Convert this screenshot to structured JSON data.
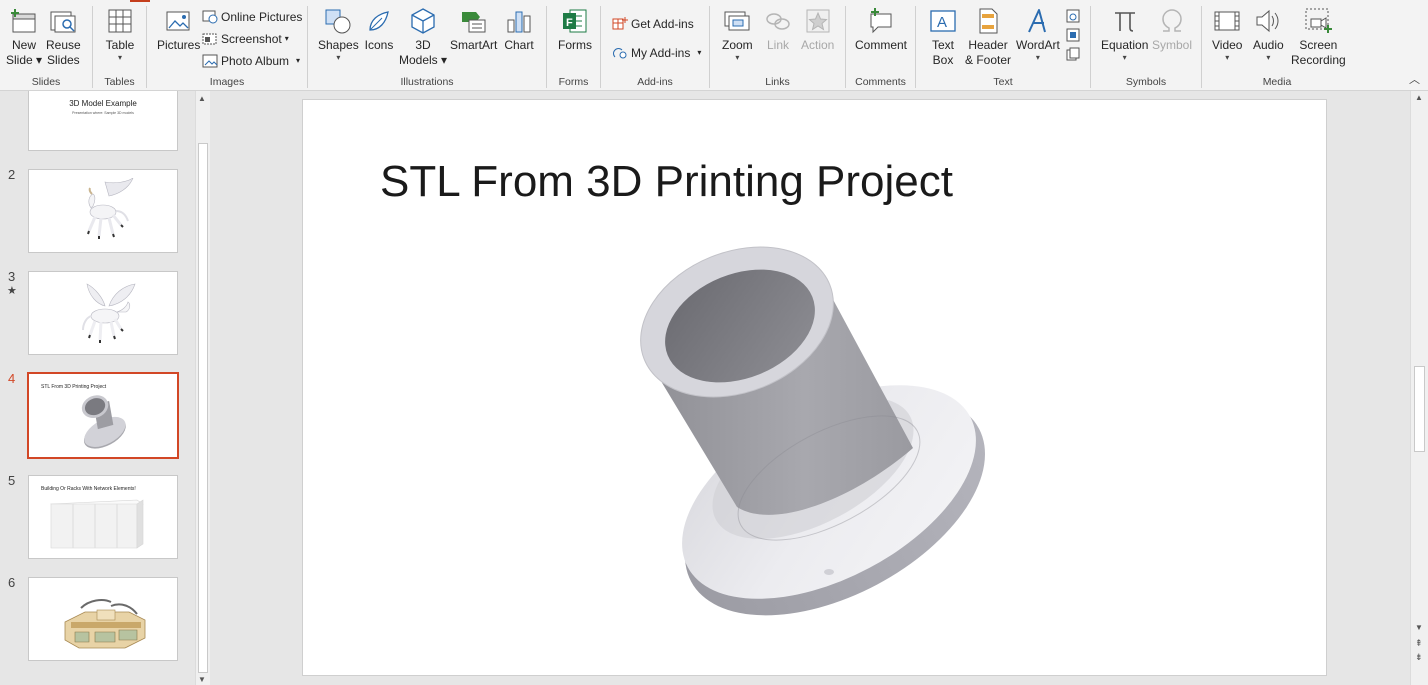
{
  "ribbon": {
    "groups": {
      "slides": "Slides",
      "tables": "Tables",
      "images": "Images",
      "illustrations": "Illustrations",
      "forms": "Forms",
      "addins": "Add-ins",
      "links": "Links",
      "comments": "Comments",
      "text": "Text",
      "symbols": "Symbols",
      "media": "Media"
    },
    "buttons": {
      "new_slide_1": "New",
      "new_slide_2": "Slide",
      "reuse_slides_1": "Reuse",
      "reuse_slides_2": "Slides",
      "table": "Table",
      "pictures": "Pictures",
      "online_pictures": "Online Pictures",
      "screenshot": "Screenshot",
      "photo_album": "Photo Album",
      "shapes": "Shapes",
      "icons": "Icons",
      "models_1": "3D",
      "models_2": "Models",
      "smartart": "SmartArt",
      "chart": "Chart",
      "forms": "Forms",
      "get_addins": "Get Add-ins",
      "my_addins": "My Add-ins",
      "zoom": "Zoom",
      "link": "Link",
      "action": "Action",
      "comment": "Comment",
      "text_box_1": "Text",
      "text_box_2": "Box",
      "header_footer_1": "Header",
      "header_footer_2": "& Footer",
      "wordart": "WordArt",
      "equation": "Equation",
      "symbol": "Symbol",
      "video": "Video",
      "audio": "Audio",
      "screen_recording_1": "Screen",
      "screen_recording_2": "Recording"
    }
  },
  "thumbnails": [
    {
      "number": "",
      "title": "3D Model Example",
      "subtitle": "Presentation where: Sample 3D models"
    },
    {
      "number": "2"
    },
    {
      "number": "3",
      "star": "★"
    },
    {
      "number": "4",
      "heading": "STL From 3D Printing Project"
    },
    {
      "number": "5",
      "heading": "Building Or Racks With Network Elements!"
    },
    {
      "number": "6"
    }
  ],
  "slide": {
    "title": "STL From 3D Printing Project"
  },
  "colors": {
    "accent": "#d24726",
    "model_light": "#d8d8dc",
    "model_dark": "#8c8c90"
  }
}
